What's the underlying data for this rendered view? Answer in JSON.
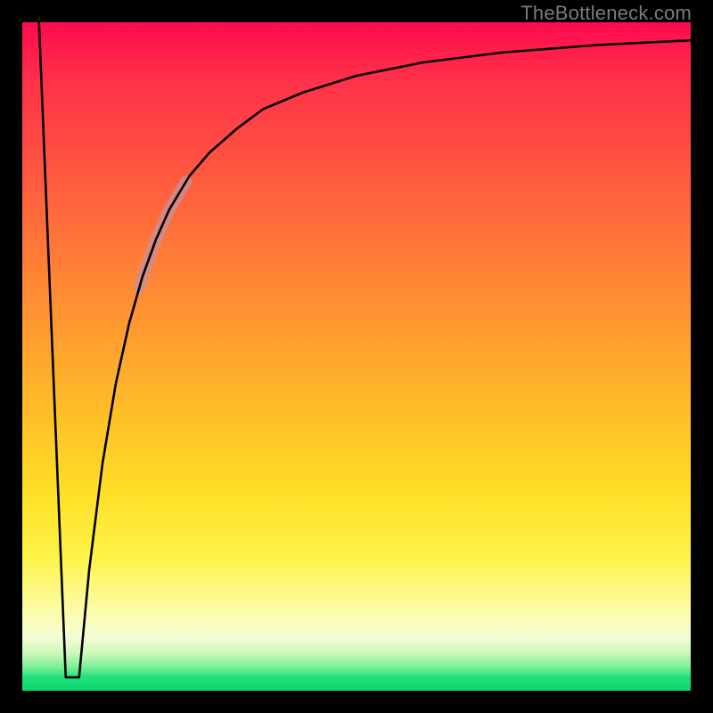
{
  "attribution": "TheBottleneck.com",
  "colors": {
    "page_bg": "#000000",
    "curve": "#000000",
    "highlight_segment": "#cc8d90",
    "gradient_top": "#ff0a4e",
    "gradient_mid": "#ffde25",
    "gradient_bottom": "#0ad66c"
  },
  "chart_data": {
    "type": "line",
    "title": "",
    "xlabel": "",
    "ylabel": "",
    "xlim": [
      0,
      100
    ],
    "ylim": [
      0,
      100
    ],
    "grid": false,
    "legend": false,
    "series": [
      {
        "name": "left-spike-down",
        "x": [
          2.5,
          6.5
        ],
        "y": [
          100,
          2
        ]
      },
      {
        "name": "left-spike-floor",
        "x": [
          6.5,
          8.5
        ],
        "y": [
          2,
          2
        ]
      },
      {
        "name": "recovery-curve",
        "x": [
          8.5,
          10,
          12,
          14,
          16,
          18,
          20,
          22,
          25,
          28,
          32,
          36,
          42,
          50,
          60,
          72,
          86,
          100
        ],
        "y": [
          2,
          18,
          34,
          46,
          55,
          62,
          67.5,
          72,
          77,
          80.5,
          84,
          87,
          89.5,
          92,
          94,
          95.5,
          96.6,
          97.3
        ]
      }
    ],
    "annotations": [
      {
        "name": "highlight-segment",
        "x_range": [
          17.5,
          24.5
        ],
        "note": "faint rosy overlay along curve"
      }
    ]
  }
}
